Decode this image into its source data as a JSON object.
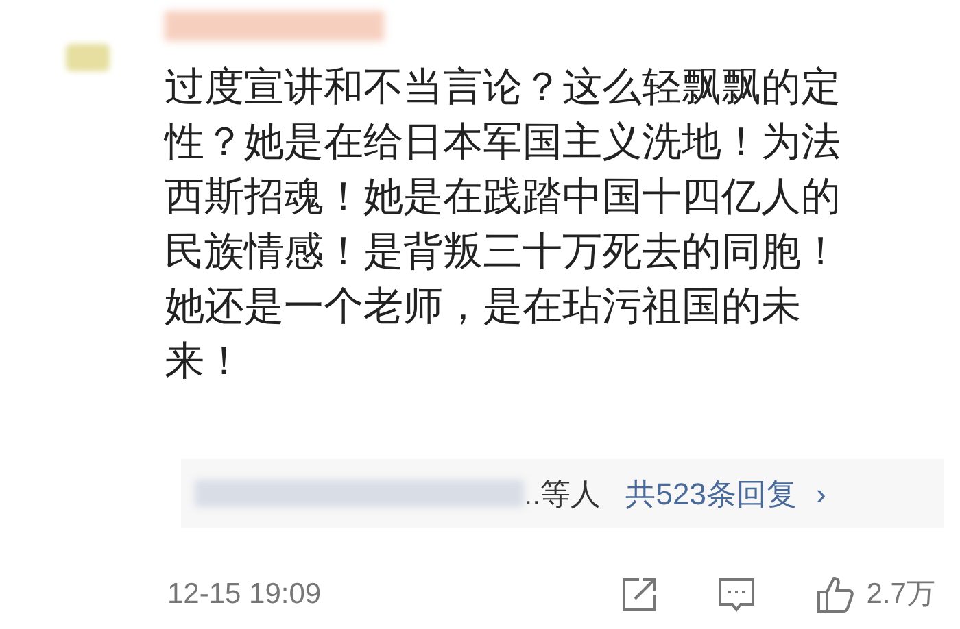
{
  "comment": {
    "text": "过度宣讲和不当言论？这么轻飘飘的定性？她是在给日本军国主义洗地！为法西斯招魂！她是在践踏中国十四亿人的民族情感！是背叛三十万死去的同胞！她还是一个老师，是在玷污祖国的未来！"
  },
  "replies": {
    "names_suffix": "..等人",
    "count_link": "共523条回复",
    "chevron": "›"
  },
  "footer": {
    "time": "12-15 19:09",
    "likes": "2.7万"
  }
}
